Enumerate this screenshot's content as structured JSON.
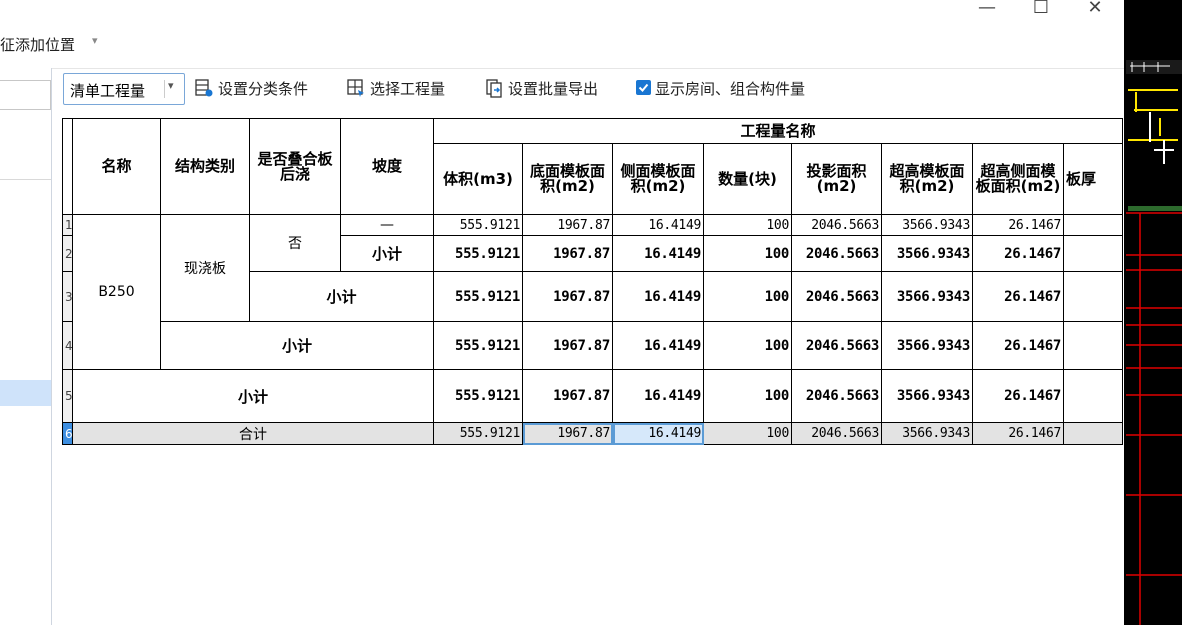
{
  "window": {
    "minimize": "—",
    "maximize": "☐",
    "close": "✕"
  },
  "menubar": {
    "position_label": "征添加位置",
    "caret": "▾"
  },
  "toolbar": {
    "mode_select": "清单工程量",
    "mode_arrow": "▾",
    "set_category_label": "设置分类条件",
    "select_quantity_label": "选择工程量",
    "batch_export_label": "设置批量导出",
    "show_rooms_checked": true,
    "show_rooms_label": "显示房间、组合构件量"
  },
  "table": {
    "headers": {
      "name": "名称",
      "struct_type": "结构类别",
      "overlay": "是否叠合板后浇",
      "slope": "坡度",
      "qty_group": "工程量名称",
      "volume": "体积(m3)",
      "bottom_form": "底面模板面积(m2)",
      "side_form": "侧面模板面积(m2)",
      "count": "数量(块)",
      "proj_area": "投影面积(m2)",
      "over_form": "超高模板面积(m2)",
      "over_side_form": "超高侧面模板面积(m2)",
      "thickness": "板厚"
    },
    "row_numbers": [
      "1",
      "2",
      "3",
      "4",
      "5",
      "6"
    ],
    "name_value": "B250",
    "struct_value": "现浇板",
    "overlay_value": "否",
    "slope_value": "—",
    "subtotal": "小计",
    "total": "合计",
    "detail_values": {
      "volume": "555.9121",
      "bottom_form": "1967.87",
      "side_form": "16.4149",
      "count": "100",
      "proj_area": "2046.5663",
      "over_form": "3566.9343",
      "over_side_form": "26.1467"
    }
  },
  "colors": {
    "selection_blue": "#3d8ee0",
    "checkbox_blue": "#1976d2",
    "cad_red": "#e00000",
    "cad_background": "#000000",
    "total_row_gray": "#e3e3e3"
  }
}
